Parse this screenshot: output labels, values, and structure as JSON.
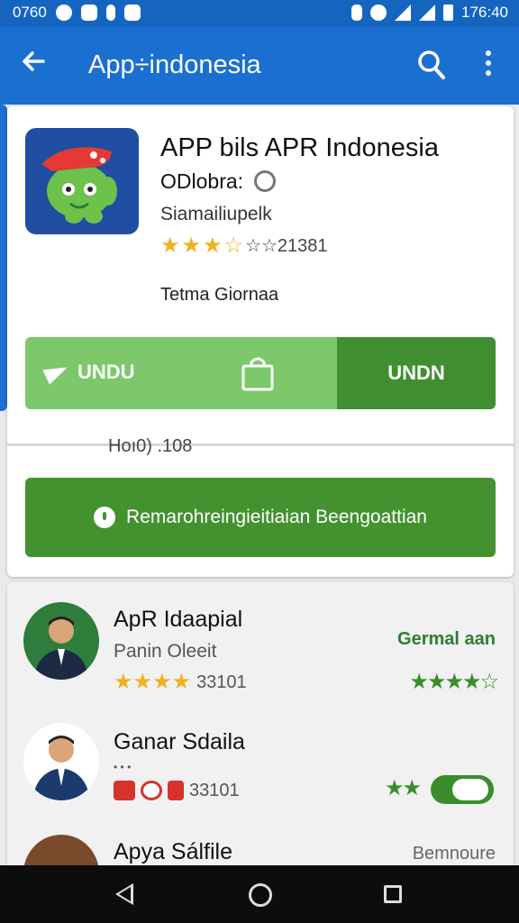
{
  "status_bar": {
    "left_time": "0760",
    "right_time": "176:40"
  },
  "app_bar": {
    "title": "App÷indonesia",
    "back_icon": "arrow-back-icon",
    "search_icon": "search-icon",
    "more_icon": "more-vert-icon"
  },
  "app": {
    "title": "APP bils APR Indonesia",
    "developer": "ODlobra:",
    "publisher": "Siamailiupelk",
    "rating_count": "☆☆21381",
    "category": "Tetma Giornaa",
    "download_left": "UNDU",
    "download_right": "UNDN",
    "size_text": "Hoı0) .108",
    "report_button": "Remarohreingieitiaian Beengoattian"
  },
  "list": [
    {
      "name": "ApR Idaapial",
      "sub": "Panin Oleeit",
      "count": "33101",
      "tag": "Germal aan"
    },
    {
      "name": "Ganar Sdaila",
      "sub": "• • •",
      "count": "33101",
      "tag": ""
    },
    {
      "name": "Apya Sálfile",
      "sub": "",
      "count": "",
      "tag": "Bemnoure"
    }
  ],
  "colors": {
    "brand_blue": "#1b6fd0",
    "green_dark": "#43922f",
    "green_light": "#7cc86a",
    "star_gold": "#f2b01e"
  }
}
